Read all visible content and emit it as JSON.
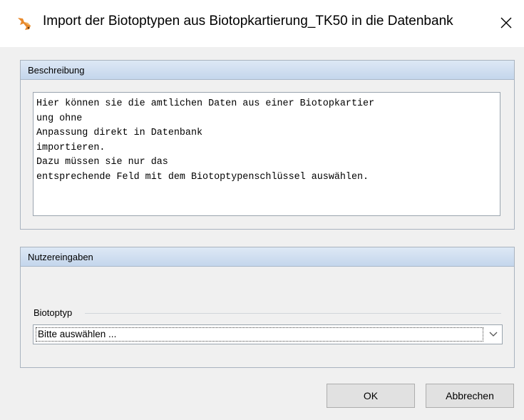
{
  "window": {
    "title": "Import der Biotoptypen aus Biotopkartierung_TK50 in die Datenbank",
    "app_icon": "fox-icon",
    "close_icon": "close-icon"
  },
  "description_panel": {
    "header": "Beschreibung",
    "text": "Hier können sie die amtlichen Daten aus einer Biotopkartier\nung ohne\nAnpassung direkt in Datenbank\nimportieren.\nDazu müssen sie nur das\nentsprechende Feld mit dem Biotoptypenschlüssel auswählen."
  },
  "input_panel": {
    "header": "Nutzereingaben",
    "field_label": "Biotoptyp",
    "select_value": "Bitte auswählen ...",
    "select_icon": "chevron-down-icon"
  },
  "buttons": {
    "ok": "OK",
    "cancel": "Abbrechen"
  },
  "colors": {
    "panel_header_top": "#dde8f5",
    "panel_header_bottom": "#c4d6ec",
    "dialog_bg": "#f0f0f0",
    "icon_orange": "#e8892b"
  }
}
